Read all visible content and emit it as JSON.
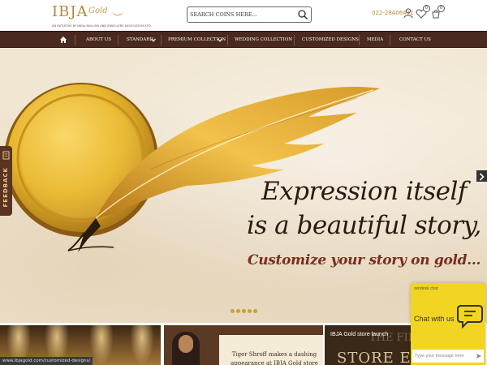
{
  "header": {
    "logo_main": "IBJA",
    "logo_gold": "Gold",
    "logo_tagline": "AN INITIATIVE BY INDIA BULLION AND JEWELLERS ASSOCIATION LTD.",
    "search": {
      "placeholder": "SEARCH COINS HERE..."
    },
    "phone": "022-28406431",
    "wishlist_count": "0",
    "cart_count": "0",
    "icons": [
      "search-icon",
      "user-icon",
      "heart-icon",
      "cart-icon"
    ]
  },
  "nav": {
    "items": [
      {
        "label": "ABOUT US"
      },
      {
        "label": "STANDARD",
        "has_dropdown": true
      },
      {
        "label": "PREMIUM COLLECTION",
        "has_dropdown": true
      },
      {
        "label": "WEDDING COLLECTION"
      },
      {
        "label": "CUSTOMIZED DESIGNS"
      },
      {
        "label": "MEDIA"
      },
      {
        "label": "CONTACT US"
      }
    ]
  },
  "hero": {
    "line1": "Expression itself",
    "line2": "is a beautiful story,",
    "line3": "Customize your story on gold...",
    "slide_count": 5
  },
  "feedback": {
    "label": "FEEDBACK"
  },
  "bottom": {
    "url": "www.ibjagold.com/customized-designs/",
    "tiger_text": "Tiger Shroff makes a dashing appearance at IBJA Gold store launch",
    "store_title": "IBJA Gold store launch",
    "store_big1": "THE FIR",
    "store_big2": "STORE EX"
  },
  "chat": {
    "brand": "zendesk chat",
    "label": "Chat with us",
    "placeholder": "Type your message here"
  },
  "colors": {
    "nav_bg": "#4a2a20",
    "gold": "#c9a230",
    "chat_yellow": "#f2d520",
    "hero_bg": "#f1e6d2"
  }
}
